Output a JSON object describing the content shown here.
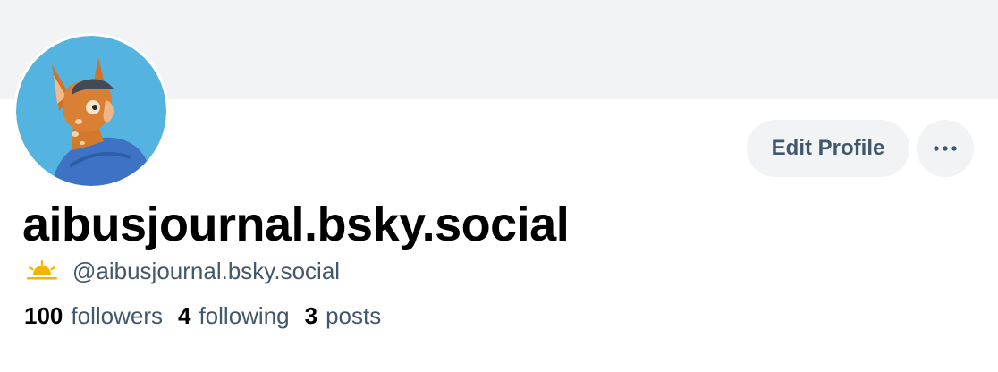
{
  "profile": {
    "display_name": "aibusjournal.bsky.social",
    "handle": "@aibusjournal.bsky.social",
    "edit_label": "Edit Profile",
    "stats": {
      "followers_count": "100",
      "followers_label": "followers",
      "following_count": "4",
      "following_label": "following",
      "posts_count": "3",
      "posts_label": "posts"
    }
  },
  "icons": {
    "badge": "sunrise-icon",
    "more": "more-horizontal-icon",
    "avatar": "avatar-image"
  },
  "colors": {
    "banner": "#f1f3f5",
    "button_bg": "#f1f3f5",
    "button_text": "#42576c",
    "secondary_text": "#42576c",
    "primary_text": "#000000",
    "badge_yellow": "#f5b400"
  }
}
